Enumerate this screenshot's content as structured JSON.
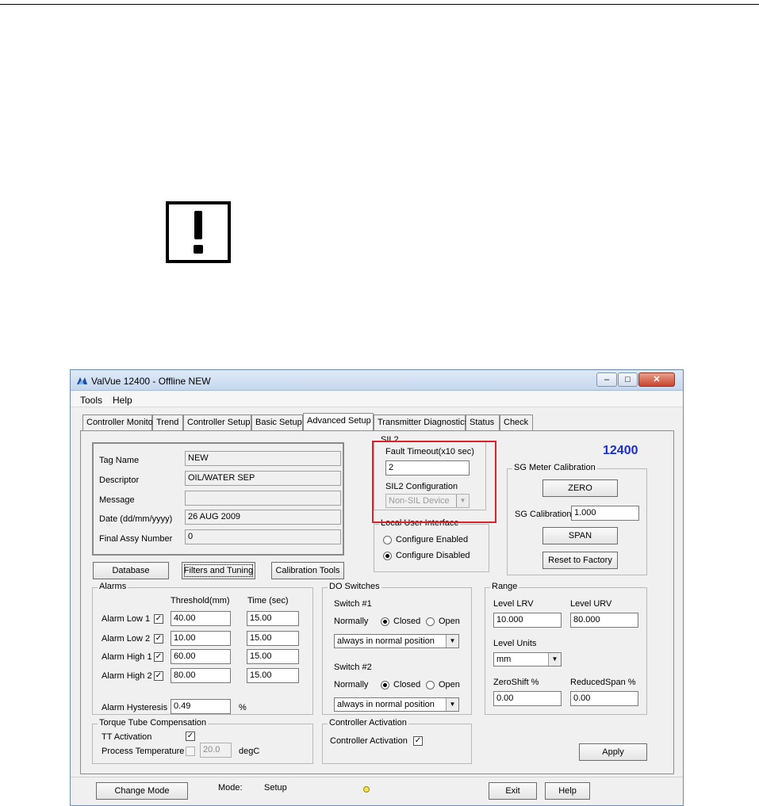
{
  "window": {
    "title": "ValVue 12400 - Offline  NEW",
    "controls": [
      "–",
      "□",
      "✕"
    ]
  },
  "menu": [
    "Tools",
    "Help"
  ],
  "tabs": [
    "Controller Monitor",
    "Trend",
    "Controller Setup",
    "Basic Setup",
    "Advanced Setup",
    "Transmitter Diagnostics",
    "Status",
    "Check"
  ],
  "info": {
    "tag_name_label": "Tag Name",
    "tag_name": "NEW",
    "descriptor_label": "Descriptor",
    "descriptor": "OIL/WATER SEP",
    "message_label": "Message",
    "message": "",
    "date_label": "Date (dd/mm/yyyy)",
    "date": "26 AUG 2009",
    "final_assy_label": "Final Assy Number",
    "final_assy": "0"
  },
  "buttons": {
    "database": "Database",
    "filters": "Filters and Tuning",
    "calibration": "Calibration Tools",
    "zero": "ZERO",
    "span": "SPAN",
    "reset": "Reset to Factory",
    "apply": "Apply",
    "change_mode": "Change Mode",
    "exit": "Exit",
    "help": "Help"
  },
  "sil2": {
    "legend": "SIL2",
    "fault_timeout_label": "Fault Timeout(x10 sec)",
    "fault_timeout": "2",
    "config_label": "SIL2 Configuration",
    "config_value": "Non-SIL Device"
  },
  "model": "12400",
  "local_ui": {
    "legend": "Local User Interface",
    "enabled": "Configure Enabled",
    "disabled": "Configure Disabled"
  },
  "sg": {
    "legend": "SG Meter Calibration",
    "calibration_label": "SG Calibration",
    "calibration": "1.000"
  },
  "alarms": {
    "legend": "Alarms",
    "threshold_header": "Threshold(mm)",
    "time_header": "Time (sec)",
    "rows": [
      {
        "label": "Alarm Low 1",
        "threshold": "40.00",
        "time": "15.00"
      },
      {
        "label": "Alarm Low 2",
        "threshold": "10.00",
        "time": "15.00"
      },
      {
        "label": "Alarm High 1",
        "threshold": "60.00",
        "time": "15.00"
      },
      {
        "label": "Alarm High 2",
        "threshold": "80.00",
        "time": "15.00"
      }
    ],
    "hysteresis_label": "Alarm Hysteresis",
    "hysteresis": "0.49",
    "hysteresis_unit": "%"
  },
  "do_switches": {
    "legend": "DO Switches",
    "switch1_label": "Switch #1",
    "switch2_label": "Switch #2",
    "normally": "Normally",
    "closed": "Closed",
    "open": "Open",
    "switch1_mode": "always in normal position",
    "switch2_mode": "always in normal position"
  },
  "range": {
    "legend": "Range",
    "lrv_label": "Level LRV",
    "lrv": "10.000",
    "urv_label": "Level URV",
    "urv": "80.000",
    "units_label": "Level Units",
    "units": "mm",
    "zero_shift_label": "ZeroShift %",
    "zero_shift": "0.00",
    "reduced_span_label": "ReducedSpan %",
    "reduced_span": "0.00"
  },
  "torque_tube": {
    "legend": "Torque Tube Compensation",
    "tt_activation": "TT Activation",
    "process_temp": "Process Temperature",
    "temp_value": "20.0",
    "temp_unit": "degC"
  },
  "controller_activation": {
    "legend": "Controller Activation",
    "label": "Controller Activation"
  },
  "status": {
    "mode_label": "Mode:",
    "mode": "Setup"
  },
  "colors": {
    "model_number": "#1c2fd1",
    "sil_highlight": "#d9222a"
  }
}
